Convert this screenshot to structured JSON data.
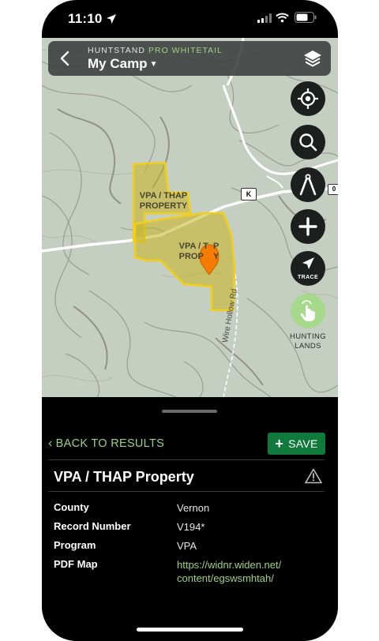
{
  "status_bar": {
    "time": "11:10"
  },
  "header": {
    "brand": "HUNTSTAND",
    "brand_tier": "PRO WHITETAIL",
    "title": "My Camp"
  },
  "map": {
    "property_label_1": "VPA / THAP\nPROPERTY",
    "property_label_2": "VPA / T  P\nPROP    Y",
    "road_k": "K",
    "road_o": "0",
    "road_name": "Wire Hollow Rd",
    "property_color": "#e8c31a",
    "marker_color": "#f57c00"
  },
  "map_controls": {
    "trace_label": "TRACE",
    "hunting_lands_label": "HUNTING\nLANDS",
    "icons": [
      "locate-icon",
      "search-icon",
      "compass-icon",
      "add-icon",
      "trace-icon",
      "hunting-lands-icon"
    ]
  },
  "sheet": {
    "back_label": "BACK TO RESULTS",
    "save_label": "SAVE",
    "title": "VPA / THAP Property",
    "rows": [
      {
        "label": "County",
        "value": "Vernon"
      },
      {
        "label": "Record Number",
        "value": "V194*"
      },
      {
        "label": "Program",
        "value": "VPA"
      },
      {
        "label": "PDF Map",
        "value": "https://widnr.widen.net/ content/egswsmhtah/"
      }
    ]
  },
  "colors": {
    "accent_green": "#9fd184",
    "save_green": "#0f7a3c"
  }
}
